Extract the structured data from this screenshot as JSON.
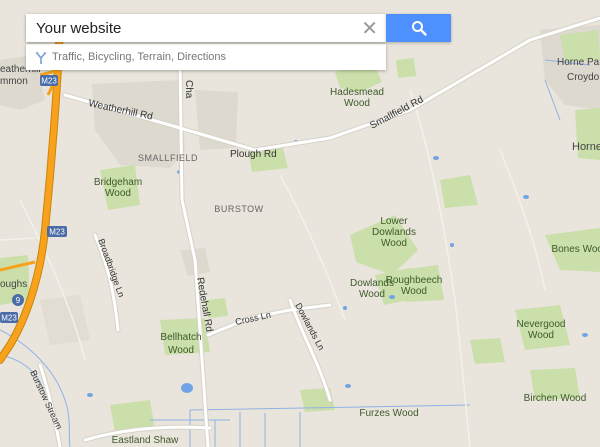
{
  "search": {
    "value": "Your website",
    "clear_label": "✕"
  },
  "layers_link": "Traffic, Bicycling, Terrain, Directions",
  "icons": {
    "search": "search-icon",
    "clear": "close-icon",
    "layers": "fork-icon"
  },
  "colors": {
    "land": "#e9e5dc",
    "motorway": "#f7a21a",
    "water": "#6fa3e6",
    "green": "#cadfaa",
    "accent": "#4d90fe"
  },
  "map": {
    "place_labels": {
      "hadesmead_1": "Hadesmead",
      "hadesmead_2": "Wood",
      "smallfield": "SMALLFIELD",
      "bridgeham_1": "Bridgeham",
      "bridgeham_2": "Wood",
      "burstow": "BURSTOW",
      "lower_1": "Lower",
      "lower_2": "Dowlands",
      "lower_3": "Wood",
      "roughbeech_1": "Roughbeech",
      "roughbeech_2": "Wood",
      "dowlands_1": "Dowlands",
      "dowlands_2": "Wood",
      "bones": "Bones Wood",
      "nevergood_1": "Nevergood",
      "nevergood_2": "Wood",
      "bellhatch_1": "Bellhatch",
      "bellhatch_2": "Wood",
      "furzes": "Furzes Wood",
      "birchen": "Birchen Wood",
      "eastland": "Eastland Shaw",
      "horne_park": "Horne Par",
      "croydo": "Croydo",
      "horne": "Horne",
      "weather_1": "eatherhill",
      "weather_2": "mmon",
      "oughs": "oughs"
    },
    "road_labels": {
      "weatherhill": "Weatherhill Rd",
      "plough": "Plough Rd",
      "smallfield": "Smallfield Rd",
      "redehall": "Redehall Rd",
      "broadbridge": "Broadbridge Ln",
      "cross": "Cross Ln",
      "dowlands": "Dowlands Ln",
      "burstow_stream": "Burstow Stream",
      "chapel": "Cha"
    },
    "shields": [
      "M23",
      "M23",
      "M23"
    ],
    "junction": "9"
  }
}
